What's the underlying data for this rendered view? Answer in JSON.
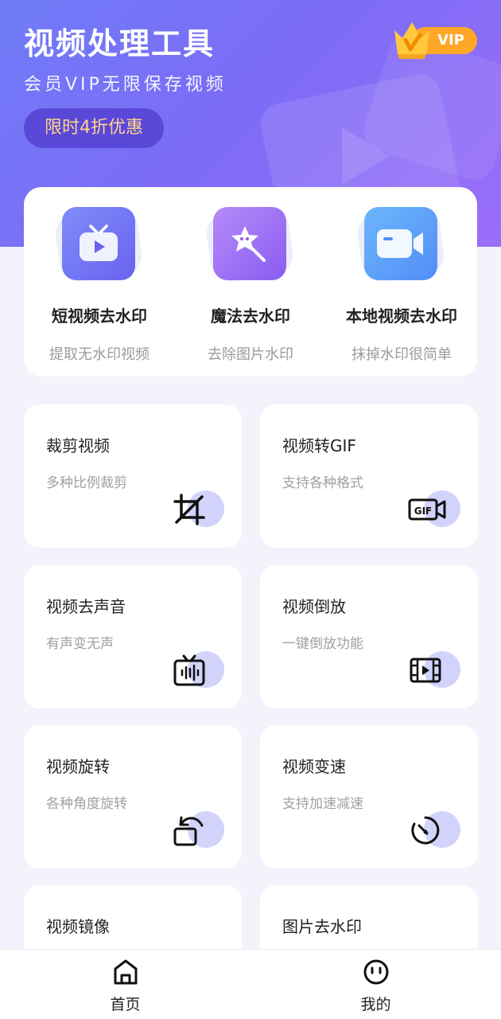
{
  "header": {
    "title": "视频处理工具",
    "subtitle": "会员VIP无限保存视频",
    "promo": "限时4折优惠",
    "vip_badge": "VIP"
  },
  "features": [
    {
      "icon": "tv-play-icon",
      "name": "短视频去水印",
      "desc": "提取无水印视频"
    },
    {
      "icon": "magic-wand-icon",
      "name": "魔法去水印",
      "desc": "去除图片水印"
    },
    {
      "icon": "video-camera-icon",
      "name": "本地视频去水印",
      "desc": "抹掉水印很简单"
    }
  ],
  "tools": [
    {
      "icon": "crop-icon",
      "name": "裁剪视频",
      "desc": "多种比例裁剪"
    },
    {
      "icon": "gif-icon",
      "name": "视频转GIF",
      "desc": "支持各种格式"
    },
    {
      "icon": "mute-audio-icon",
      "name": "视频去声音",
      "desc": "有声变无声"
    },
    {
      "icon": "film-reverse-icon",
      "name": "视频倒放",
      "desc": "一键倒放功能"
    },
    {
      "icon": "rotate-icon",
      "name": "视频旋转",
      "desc": "各种角度旋转"
    },
    {
      "icon": "speed-timer-icon",
      "name": "视频变速",
      "desc": "支持加速减速"
    },
    {
      "icon": "mirror-icon",
      "name": "视频镜像",
      "desc": ""
    },
    {
      "icon": "image-watermark-icon",
      "name": "图片去水印",
      "desc": ""
    }
  ],
  "tabbar": {
    "items": [
      {
        "icon": "home-icon",
        "label": "首页"
      },
      {
        "icon": "profile-face-icon",
        "label": "我的"
      }
    ]
  },
  "colors": {
    "accent": "#7c6cf6",
    "promo_text": "#ffd48a",
    "vip_orange": "#ffa726",
    "icon_dot": "#d2d3fb"
  }
}
